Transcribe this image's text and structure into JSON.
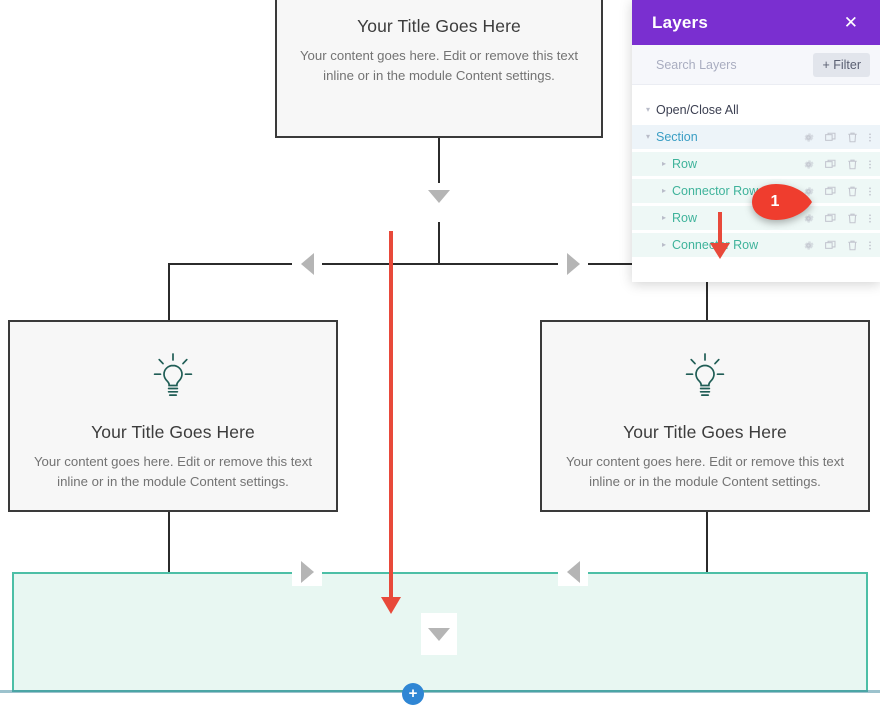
{
  "canvas": {
    "cards": [
      {
        "id": "top-card",
        "title": "Your Title Goes Here",
        "body": "Your content goes here. Edit or remove this text inline or in the module Content settings.",
        "has_icon": false,
        "icon": "lightbulb-icon"
      },
      {
        "id": "left-card",
        "title": "Your Title Goes Here",
        "body": "Your content goes here. Edit or remove this text inline or in the module Content settings.",
        "has_icon": true,
        "icon": "lightbulb-icon"
      },
      {
        "id": "right-card",
        "title": "Your Title Goes Here",
        "body": "Your content goes here. Edit or remove this text inline or in the module Content settings.",
        "has_icon": true,
        "icon": "lightbulb-icon"
      }
    ],
    "add_section_label": "+",
    "colors": {
      "card_bg": "#f7f7f7",
      "card_border": "#3a3a3a",
      "connector_line": "#2b2b2b",
      "connector_arrow": "#b5b5b5",
      "section_highlight_bg": "#e8f7f2",
      "section_highlight_border": "#4cbfa6",
      "add_button": "#2f86d4",
      "icon_teal": "#1f5d55"
    }
  },
  "annotation": {
    "marker_number": "1",
    "color": "#e8493a"
  },
  "layers_panel": {
    "title": "Layers",
    "close_label": "✕",
    "search": {
      "placeholder": "Search Layers",
      "value": ""
    },
    "filter_label": "+ Filter",
    "header_color": "#7a2fd0",
    "rows": [
      {
        "label": "Open/Close All",
        "caret": "▾",
        "kind": "toggle-all",
        "actions": false
      },
      {
        "label": "Section",
        "caret": "▾",
        "kind": "section",
        "actions": true
      },
      {
        "label": "Row",
        "caret": "▸",
        "kind": "row",
        "actions": true
      },
      {
        "label": "Connector Row",
        "caret": "▸",
        "kind": "row",
        "actions": true
      },
      {
        "label": "Row",
        "caret": "▸",
        "kind": "row",
        "actions": true
      },
      {
        "label": "Connector Row",
        "caret": "▸",
        "kind": "row",
        "actions": true
      }
    ],
    "row_action_icons": [
      "gear-icon",
      "duplicate-icon",
      "trash-icon",
      "more-options-icon"
    ]
  }
}
